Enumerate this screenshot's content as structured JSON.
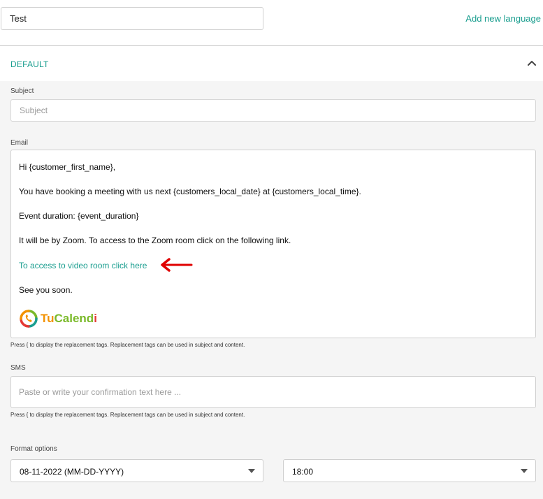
{
  "header": {
    "name_value": "Test",
    "add_language_label": "Add new language"
  },
  "panel": {
    "title": "DEFAULT",
    "subject": {
      "label": "Subject",
      "placeholder": "Subject",
      "value": ""
    },
    "email": {
      "label": "Email",
      "lines": [
        "Hi  {customer_first_name},",
        "You have booking a meeting with us next {customers_local_date} at {customers_local_time}.",
        "Event duration: {event_duration}",
        "It will be by Zoom. To access to the Zoom room click on the following link.",
        "To access to video room click here",
        "See you soon."
      ],
      "logo_text_a": "Tu",
      "logo_text_b": "Calend",
      "logo_text_c": "i"
    },
    "hint": "Press { to display the replacement tags. Replacement tags can be used in subject and content.",
    "sms": {
      "label": "SMS",
      "placeholder": "Paste or write your confirmation text here ...",
      "value": ""
    },
    "format": {
      "label": "Format options",
      "date_value": "08-11-2022 (MM-DD-YYYY)",
      "time_value": "18:00"
    }
  },
  "colors": {
    "accent": "#1a9e8f",
    "arrow": "#e00000",
    "logo_orange": "#f39200",
    "logo_green": "#7ab929",
    "logo_teal": "#1a9e8f",
    "logo_red": "#e53935"
  }
}
